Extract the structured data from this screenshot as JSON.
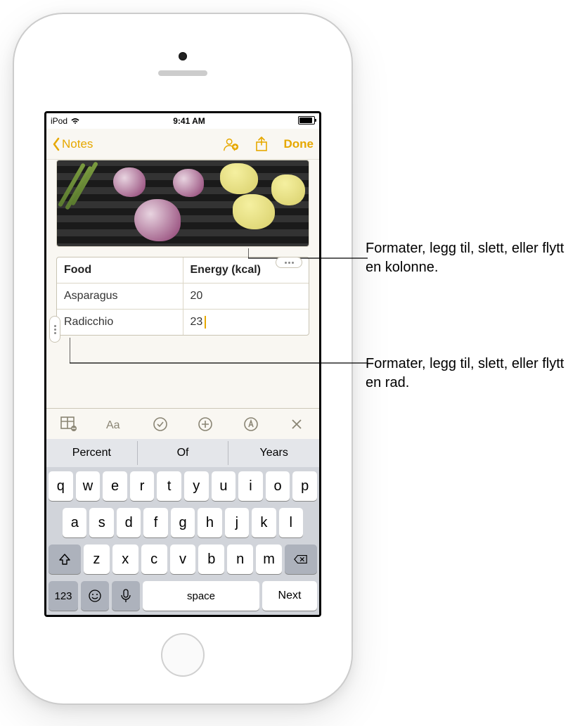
{
  "status_bar": {
    "device": "iPod",
    "time": "9:41 AM"
  },
  "nav": {
    "back_label": "Notes",
    "done_label": "Done"
  },
  "table": {
    "headers": [
      "Food",
      "Energy (kcal)"
    ],
    "rows": [
      [
        "Asparagus",
        "20"
      ],
      [
        "Radicchio",
        "23"
      ]
    ]
  },
  "suggestions": [
    "Percent",
    "Of",
    "Years"
  ],
  "keyboard": {
    "row1": [
      "q",
      "w",
      "e",
      "r",
      "t",
      "y",
      "u",
      "i",
      "o",
      "p"
    ],
    "row2": [
      "a",
      "s",
      "d",
      "f",
      "g",
      "h",
      "j",
      "k",
      "l"
    ],
    "row3": [
      "z",
      "x",
      "c",
      "v",
      "b",
      "n",
      "m"
    ],
    "num_key": "123",
    "space_key": "space",
    "next_key": "Next"
  },
  "callouts": {
    "column": "Formater, legg til, slett, eller flytt en kolonne.",
    "row": "Formater, legg til, slett, eller flytt en rad."
  }
}
